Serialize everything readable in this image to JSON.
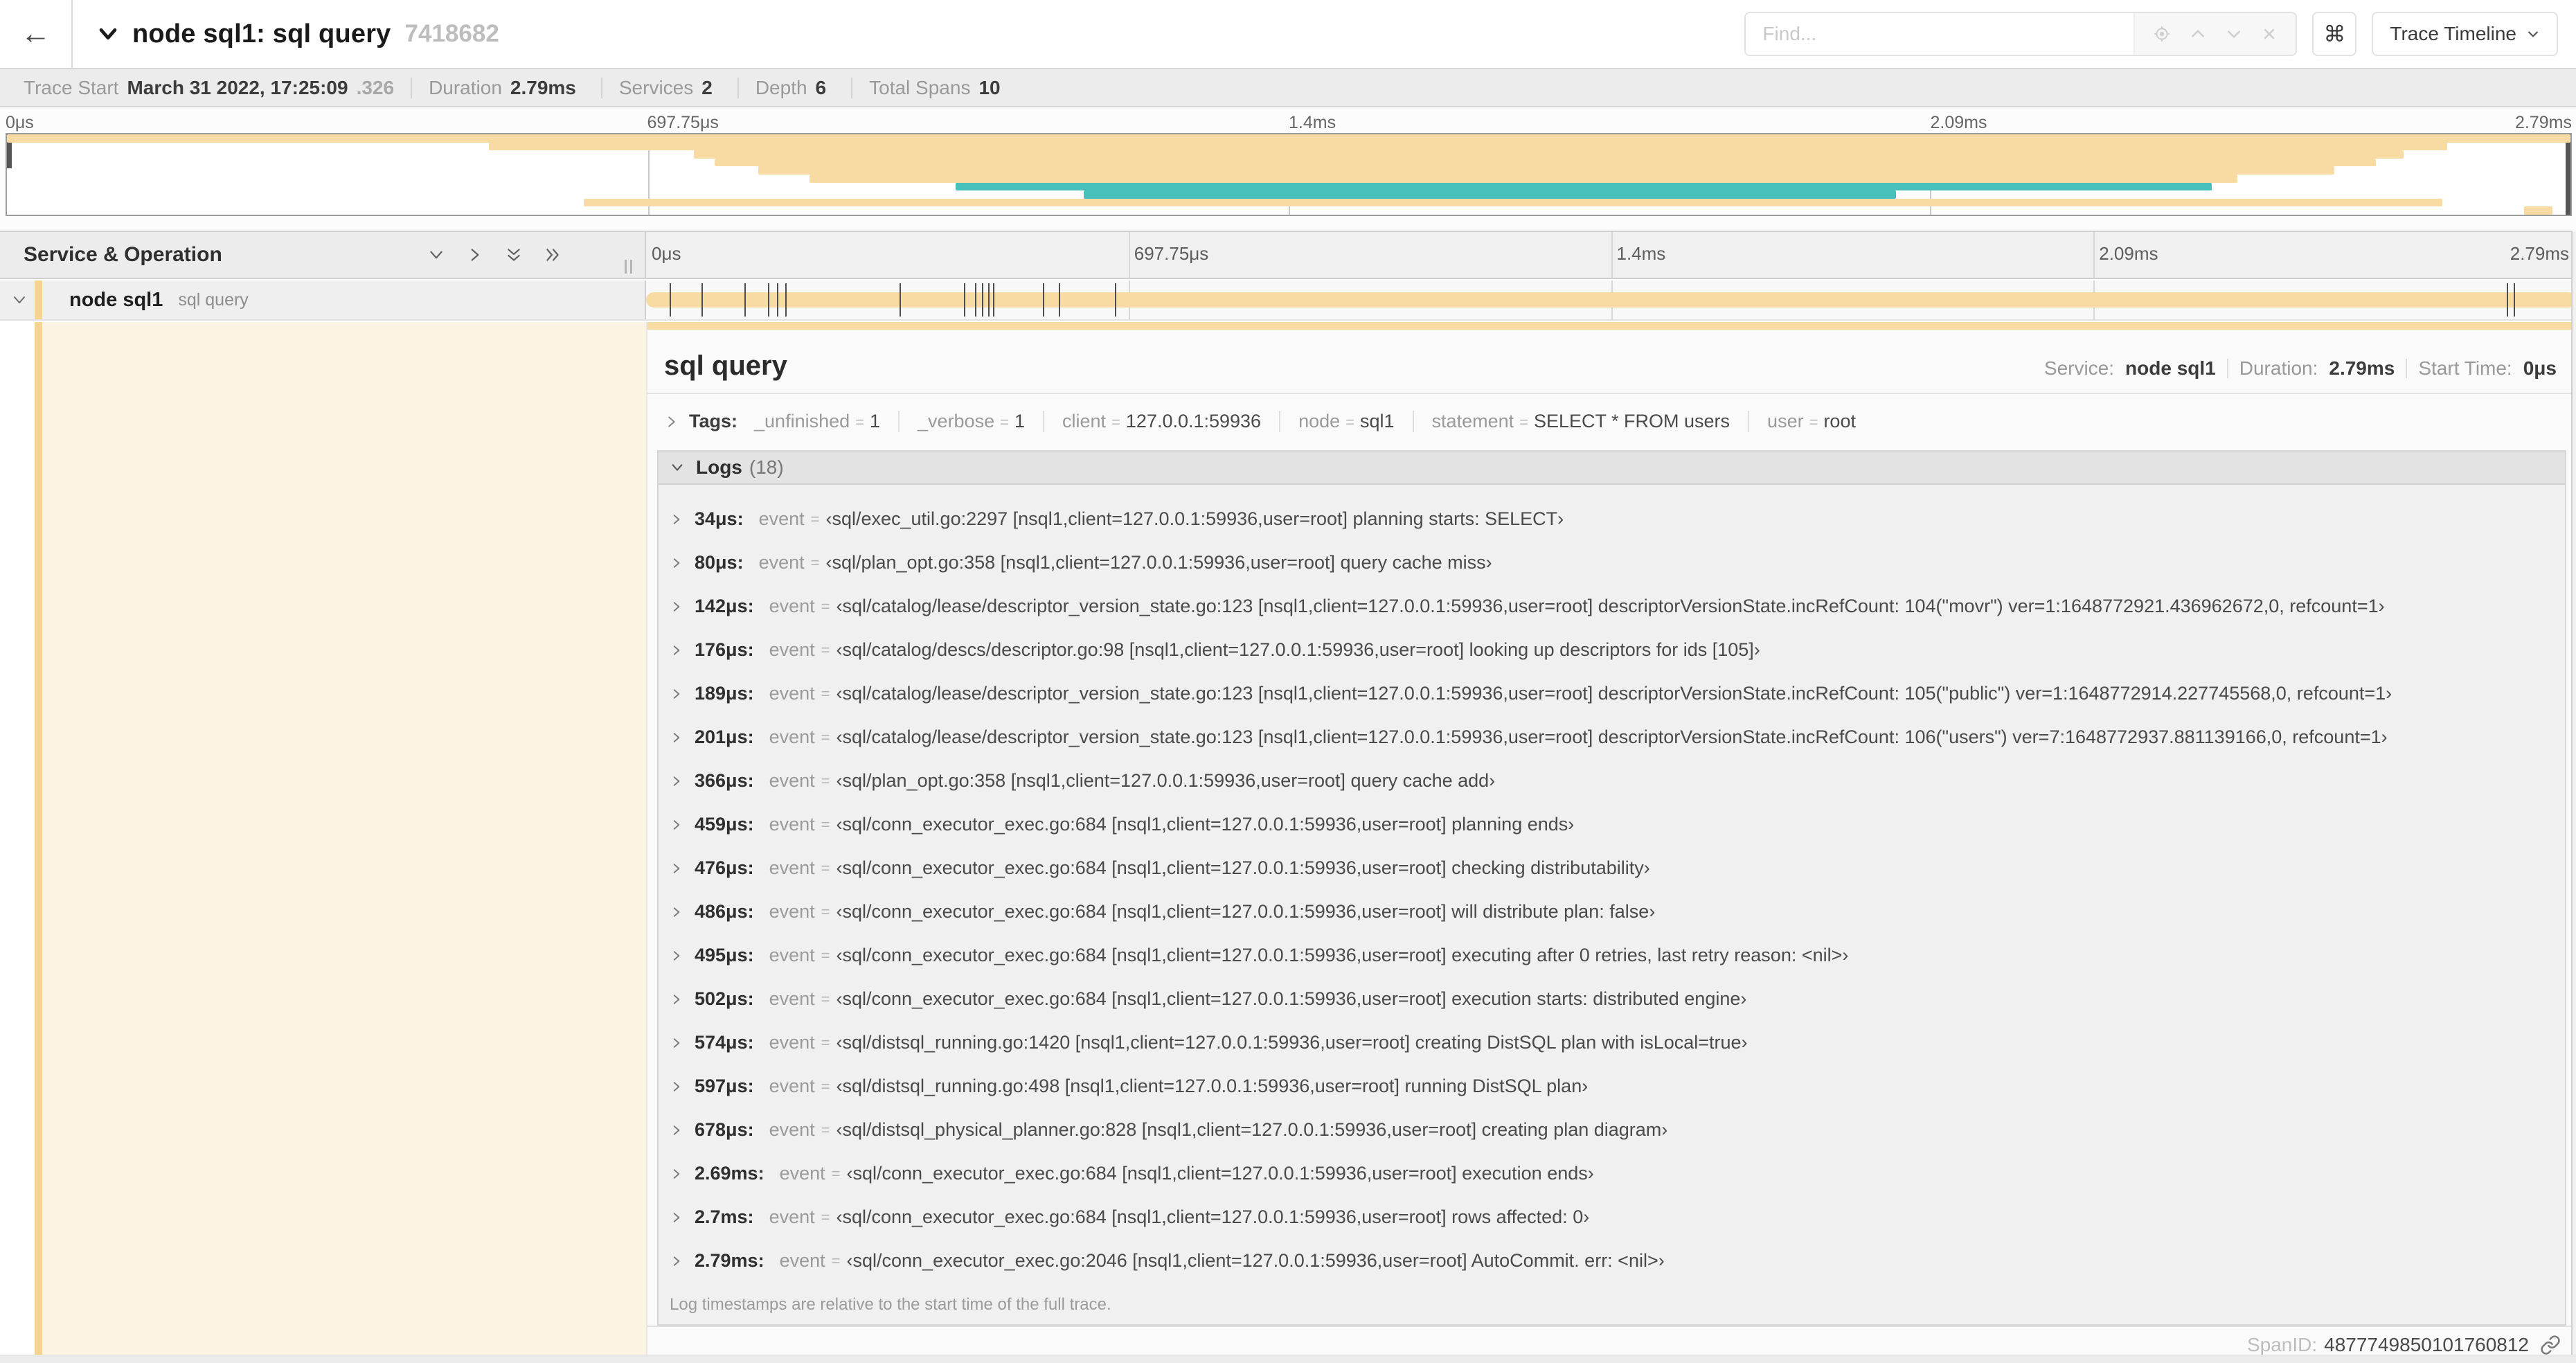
{
  "topbar": {
    "title": "node sql1: sql query",
    "trace_id_short": "7418682",
    "find_placeholder": "Find...",
    "shortcut_symbol": "⌘",
    "view_selector_label": "Trace Timeline"
  },
  "trace_info": {
    "items": [
      {
        "label": "Trace Start",
        "value": "March 31 2022, 17:25:09",
        "suffix": ".326"
      },
      {
        "label": "Duration",
        "value": "2.79ms",
        "suffix": ""
      },
      {
        "label": "Services",
        "value": "2",
        "suffix": ""
      },
      {
        "label": "Depth",
        "value": "6",
        "suffix": ""
      },
      {
        "label": "Total Spans",
        "value": "10",
        "suffix": ""
      }
    ]
  },
  "timeline": {
    "duration_us": 2790,
    "ticks": [
      "0μs",
      "697.75μs",
      "1.4ms",
      "2.09ms",
      "2.79ms"
    ]
  },
  "minimap": {
    "rows": [
      {
        "start_pct": 0,
        "end_pct": 100,
        "color": "orange"
      },
      {
        "start_pct": 18.8,
        "end_pct": 95.2,
        "color": "orange"
      },
      {
        "start_pct": 26.8,
        "end_pct": 93.5,
        "color": "orange"
      },
      {
        "start_pct": 27.6,
        "end_pct": 92.4,
        "color": "orange"
      },
      {
        "start_pct": 29.3,
        "end_pct": 90.8,
        "color": "orange"
      },
      {
        "start_pct": 31.3,
        "end_pct": 87.0,
        "color": "orange"
      },
      {
        "start_pct": 37.0,
        "end_pct": 86.0,
        "color": "teal"
      },
      {
        "start_pct": 42.0,
        "end_pct": 73.7,
        "color": "teal"
      },
      {
        "start_pct": 22.5,
        "end_pct": 95.0,
        "color": "orange"
      },
      {
        "start_pct": 98.2,
        "end_pct": 99.3,
        "color": "orange"
      }
    ]
  },
  "sno_header": {
    "title": "Service & Operation"
  },
  "span_row": {
    "service": "node sql1",
    "operation": "sql query"
  },
  "detail": {
    "title": "sql query",
    "meta": {
      "service_label": "Service:",
      "service": "node sql1",
      "duration_label": "Duration:",
      "duration": "2.79ms",
      "start_label": "Start Time:",
      "start": "0μs"
    },
    "tags_label": "Tags:",
    "tags": [
      {
        "key": "_unfinished",
        "value": "1"
      },
      {
        "key": "_verbose",
        "value": "1"
      },
      {
        "key": "client",
        "value": "127.0.0.1:59936"
      },
      {
        "key": "node",
        "value": "sql1"
      },
      {
        "key": "statement",
        "value": "SELECT * FROM users"
      },
      {
        "key": "user",
        "value": "root"
      }
    ],
    "logs_label": "Logs",
    "logs_count": "(18)",
    "logs": [
      {
        "time": "34μs:",
        "t_us": 34,
        "field": "event",
        "value": "‹sql/exec_util.go:2297 [nsql1,client=127.0.0.1:59936,user=root] planning starts: SELECT›"
      },
      {
        "time": "80μs:",
        "t_us": 80,
        "field": "event",
        "value": "‹sql/plan_opt.go:358 [nsql1,client=127.0.0.1:59936,user=root] query cache miss›"
      },
      {
        "time": "142μs:",
        "t_us": 142,
        "field": "event",
        "value": "‹sql/catalog/lease/descriptor_version_state.go:123 [nsql1,client=127.0.0.1:59936,user=root] descriptorVersionState.incRefCount: 104(\"movr\") ver=1:1648772921.436962672,0, refcount=1›"
      },
      {
        "time": "176μs:",
        "t_us": 176,
        "field": "event",
        "value": "‹sql/catalog/descs/descriptor.go:98 [nsql1,client=127.0.0.1:59936,user=root] looking up descriptors for ids [105]›"
      },
      {
        "time": "189μs:",
        "t_us": 189,
        "field": "event",
        "value": "‹sql/catalog/lease/descriptor_version_state.go:123 [nsql1,client=127.0.0.1:59936,user=root] descriptorVersionState.incRefCount: 105(\"public\") ver=1:1648772914.227745568,0, refcount=1›"
      },
      {
        "time": "201μs:",
        "t_us": 201,
        "field": "event",
        "value": "‹sql/catalog/lease/descriptor_version_state.go:123 [nsql1,client=127.0.0.1:59936,user=root] descriptorVersionState.incRefCount: 106(\"users\") ver=7:1648772937.881139166,0, refcount=1›"
      },
      {
        "time": "366μs:",
        "t_us": 366,
        "field": "event",
        "value": "‹sql/plan_opt.go:358 [nsql1,client=127.0.0.1:59936,user=root] query cache add›"
      },
      {
        "time": "459μs:",
        "t_us": 459,
        "field": "event",
        "value": "‹sql/conn_executor_exec.go:684 [nsql1,client=127.0.0.1:59936,user=root] planning ends›"
      },
      {
        "time": "476μs:",
        "t_us": 476,
        "field": "event",
        "value": "‹sql/conn_executor_exec.go:684 [nsql1,client=127.0.0.1:59936,user=root] checking distributability›"
      },
      {
        "time": "486μs:",
        "t_us": 486,
        "field": "event",
        "value": "‹sql/conn_executor_exec.go:684 [nsql1,client=127.0.0.1:59936,user=root] will distribute plan: false›"
      },
      {
        "time": "495μs:",
        "t_us": 495,
        "field": "event",
        "value": "‹sql/conn_executor_exec.go:684 [nsql1,client=127.0.0.1:59936,user=root] executing after 0 retries, last retry reason: <nil>›"
      },
      {
        "time": "502μs:",
        "t_us": 502,
        "field": "event",
        "value": "‹sql/conn_executor_exec.go:684 [nsql1,client=127.0.0.1:59936,user=root] execution starts: distributed engine›"
      },
      {
        "time": "574μs:",
        "t_us": 574,
        "field": "event",
        "value": "‹sql/distsql_running.go:1420 [nsql1,client=127.0.0.1:59936,user=root] creating DistSQL plan with isLocal=true›"
      },
      {
        "time": "597μs:",
        "t_us": 597,
        "field": "event",
        "value": "‹sql/distsql_running.go:498 [nsql1,client=127.0.0.1:59936,user=root] running DistSQL plan›"
      },
      {
        "time": "678μs:",
        "t_us": 678,
        "field": "event",
        "value": "‹sql/distsql_physical_planner.go:828 [nsql1,client=127.0.0.1:59936,user=root] creating plan diagram›"
      },
      {
        "time": "2.69ms:",
        "t_us": 2690,
        "field": "event",
        "value": "‹sql/conn_executor_exec.go:684 [nsql1,client=127.0.0.1:59936,user=root] execution ends›"
      },
      {
        "time": "2.7ms:",
        "t_us": 2700,
        "field": "event",
        "value": "‹sql/conn_executor_exec.go:684 [nsql1,client=127.0.0.1:59936,user=root] rows affected: 0›"
      },
      {
        "time": "2.79ms:",
        "t_us": 2790,
        "field": "event",
        "value": "‹sql/conn_executor_exec.go:2046 [nsql1,client=127.0.0.1:59936,user=root] AutoCommit. err: <nil>›"
      }
    ],
    "logs_note": "Log timestamps are relative to the start time of the full trace.",
    "spanid_label": "SpanID:",
    "spanid": "4877749850101760812"
  },
  "colors": {
    "orange": "#F8DBA2",
    "teal": "#45C0BA",
    "cream": "#FCF4E2",
    "accent": "#F5D491"
  }
}
